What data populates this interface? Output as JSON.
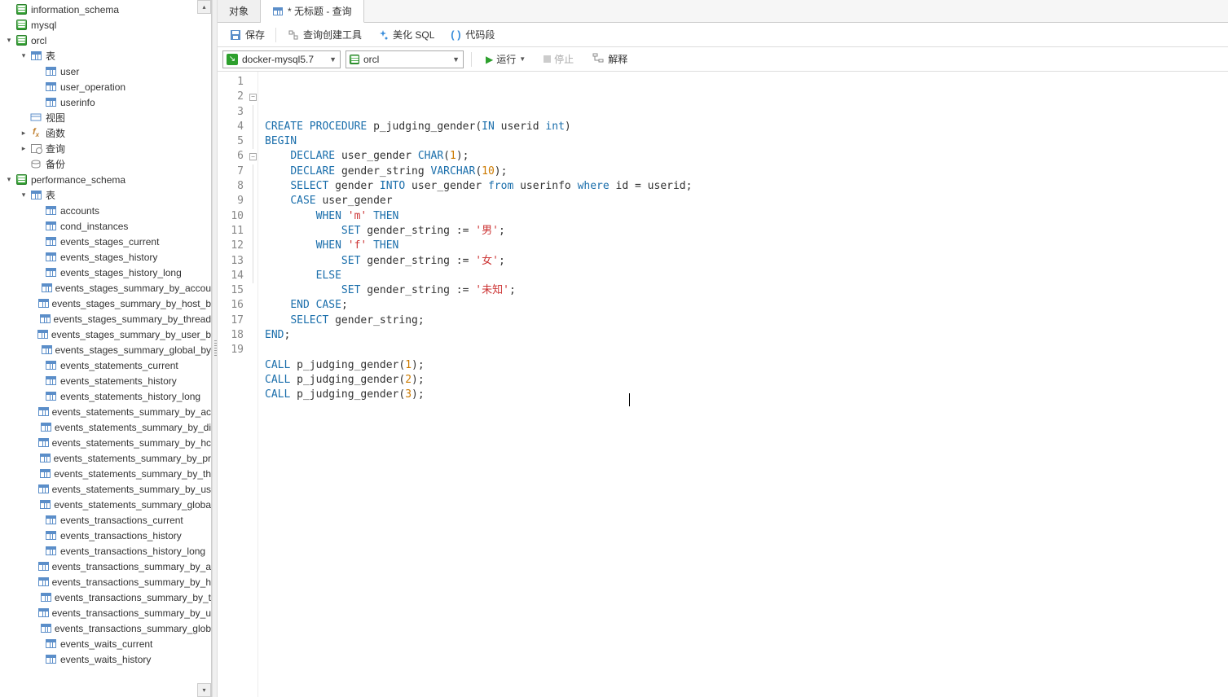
{
  "sidebar": {
    "nodes": [
      {
        "depth": 0,
        "arrow": "none",
        "icon": "db",
        "label": "information_schema"
      },
      {
        "depth": 0,
        "arrow": "none",
        "icon": "db",
        "label": "mysql"
      },
      {
        "depth": 0,
        "arrow": "open",
        "icon": "db",
        "label": "orcl"
      },
      {
        "depth": 1,
        "arrow": "open",
        "icon": "folder-table",
        "label": "表"
      },
      {
        "depth": 2,
        "arrow": "none",
        "icon": "table",
        "label": "user"
      },
      {
        "depth": 2,
        "arrow": "none",
        "icon": "table",
        "label": "user_operation"
      },
      {
        "depth": 2,
        "arrow": "none",
        "icon": "table",
        "label": "userinfo"
      },
      {
        "depth": 1,
        "arrow": "none",
        "icon": "view",
        "label": "视图"
      },
      {
        "depth": 1,
        "arrow": "closed",
        "icon": "fx",
        "label": "函数"
      },
      {
        "depth": 1,
        "arrow": "closed",
        "icon": "query",
        "label": "查询"
      },
      {
        "depth": 1,
        "arrow": "none",
        "icon": "backup",
        "label": "备份"
      },
      {
        "depth": 0,
        "arrow": "open",
        "icon": "db",
        "label": "performance_schema"
      },
      {
        "depth": 1,
        "arrow": "open",
        "icon": "folder-table",
        "label": "表"
      },
      {
        "depth": 2,
        "arrow": "none",
        "icon": "table",
        "label": "accounts"
      },
      {
        "depth": 2,
        "arrow": "none",
        "icon": "table",
        "label": "cond_instances"
      },
      {
        "depth": 2,
        "arrow": "none",
        "icon": "table",
        "label": "events_stages_current"
      },
      {
        "depth": 2,
        "arrow": "none",
        "icon": "table",
        "label": "events_stages_history"
      },
      {
        "depth": 2,
        "arrow": "none",
        "icon": "table",
        "label": "events_stages_history_long"
      },
      {
        "depth": 2,
        "arrow": "none",
        "icon": "table",
        "label": "events_stages_summary_by_accou"
      },
      {
        "depth": 2,
        "arrow": "none",
        "icon": "table",
        "label": "events_stages_summary_by_host_b"
      },
      {
        "depth": 2,
        "arrow": "none",
        "icon": "table",
        "label": "events_stages_summary_by_thread"
      },
      {
        "depth": 2,
        "arrow": "none",
        "icon": "table",
        "label": "events_stages_summary_by_user_b"
      },
      {
        "depth": 2,
        "arrow": "none",
        "icon": "table",
        "label": "events_stages_summary_global_by"
      },
      {
        "depth": 2,
        "arrow": "none",
        "icon": "table",
        "label": "events_statements_current"
      },
      {
        "depth": 2,
        "arrow": "none",
        "icon": "table",
        "label": "events_statements_history"
      },
      {
        "depth": 2,
        "arrow": "none",
        "icon": "table",
        "label": "events_statements_history_long"
      },
      {
        "depth": 2,
        "arrow": "none",
        "icon": "table",
        "label": "events_statements_summary_by_ac"
      },
      {
        "depth": 2,
        "arrow": "none",
        "icon": "table",
        "label": "events_statements_summary_by_di"
      },
      {
        "depth": 2,
        "arrow": "none",
        "icon": "table",
        "label": "events_statements_summary_by_hc"
      },
      {
        "depth": 2,
        "arrow": "none",
        "icon": "table",
        "label": "events_statements_summary_by_pr"
      },
      {
        "depth": 2,
        "arrow": "none",
        "icon": "table",
        "label": "events_statements_summary_by_th"
      },
      {
        "depth": 2,
        "arrow": "none",
        "icon": "table",
        "label": "events_statements_summary_by_us"
      },
      {
        "depth": 2,
        "arrow": "none",
        "icon": "table",
        "label": "events_statements_summary_globa"
      },
      {
        "depth": 2,
        "arrow": "none",
        "icon": "table",
        "label": "events_transactions_current"
      },
      {
        "depth": 2,
        "arrow": "none",
        "icon": "table",
        "label": "events_transactions_history"
      },
      {
        "depth": 2,
        "arrow": "none",
        "icon": "table",
        "label": "events_transactions_history_long"
      },
      {
        "depth": 2,
        "arrow": "none",
        "icon": "table",
        "label": "events_transactions_summary_by_a"
      },
      {
        "depth": 2,
        "arrow": "none",
        "icon": "table",
        "label": "events_transactions_summary_by_h"
      },
      {
        "depth": 2,
        "arrow": "none",
        "icon": "table",
        "label": "events_transactions_summary_by_t"
      },
      {
        "depth": 2,
        "arrow": "none",
        "icon": "table",
        "label": "events_transactions_summary_by_u"
      },
      {
        "depth": 2,
        "arrow": "none",
        "icon": "table",
        "label": "events_transactions_summary_glob"
      },
      {
        "depth": 2,
        "arrow": "none",
        "icon": "table",
        "label": "events_waits_current"
      },
      {
        "depth": 2,
        "arrow": "none",
        "icon": "table",
        "label": "events_waits_history"
      }
    ]
  },
  "tabs": {
    "objects_label": "对象",
    "query_label": "* 无标题 - 查询"
  },
  "toolbar": {
    "save": "保存",
    "builder": "查询创建工具",
    "beautify": "美化 SQL",
    "snippet": "代码段"
  },
  "connrow": {
    "connection": "docker-mysql5.7",
    "database": "orcl",
    "run": "运行",
    "stop": "停止",
    "explain": "解释"
  },
  "code": {
    "lines": [
      {
        "n": 1,
        "tokens": [
          [
            "kw",
            "CREATE"
          ],
          [
            " ",
            " "
          ],
          [
            "kw",
            "PROCEDURE"
          ],
          [
            " ",
            " "
          ],
          [
            "ident",
            "p_judging_gender"
          ],
          [
            "paren",
            "("
          ],
          [
            "kw",
            "IN"
          ],
          [
            " ",
            " "
          ],
          [
            "ident",
            "userid "
          ],
          [
            "type",
            "int"
          ],
          [
            "paren",
            ")"
          ]
        ]
      },
      {
        "n": 2,
        "fold": "open",
        "tokens": [
          [
            "kw",
            "BEGIN"
          ]
        ]
      },
      {
        "n": 3,
        "tokens": [
          [
            " ",
            "    "
          ],
          [
            "kw",
            "DECLARE"
          ],
          [
            " ",
            " "
          ],
          [
            "ident",
            "user_gender "
          ],
          [
            "type",
            "CHAR"
          ],
          [
            "paren",
            "("
          ],
          [
            "num",
            "1"
          ],
          [
            "paren",
            ")"
          ],
          [
            "ident",
            ";"
          ]
        ]
      },
      {
        "n": 4,
        "tokens": [
          [
            " ",
            "    "
          ],
          [
            "kw",
            "DECLARE"
          ],
          [
            " ",
            " "
          ],
          [
            "ident",
            "gender_string "
          ],
          [
            "type",
            "VARCHAR"
          ],
          [
            "paren",
            "("
          ],
          [
            "num",
            "10"
          ],
          [
            "paren",
            ")"
          ],
          [
            "ident",
            ";"
          ]
        ]
      },
      {
        "n": 5,
        "tokens": [
          [
            " ",
            "    "
          ],
          [
            "kw",
            "SELECT"
          ],
          [
            " ",
            " "
          ],
          [
            "ident",
            "gender "
          ],
          [
            "kw",
            "INTO"
          ],
          [
            " ",
            " "
          ],
          [
            "ident",
            "user_gender "
          ],
          [
            "kw",
            "from"
          ],
          [
            " ",
            " "
          ],
          [
            "ident",
            "userinfo "
          ],
          [
            "kw",
            "where"
          ],
          [
            " ",
            " "
          ],
          [
            "ident",
            "id = userid;"
          ]
        ]
      },
      {
        "n": 6,
        "fold": "open",
        "tokens": [
          [
            " ",
            "    "
          ],
          [
            "kw",
            "CASE"
          ],
          [
            " ",
            " "
          ],
          [
            "ident",
            "user_gender"
          ]
        ]
      },
      {
        "n": 7,
        "tokens": [
          [
            " ",
            "        "
          ],
          [
            "kw",
            "WHEN"
          ],
          [
            " ",
            " "
          ],
          [
            "str",
            "'m'"
          ],
          [
            " ",
            " "
          ],
          [
            "kw",
            "THEN"
          ]
        ]
      },
      {
        "n": 8,
        "tokens": [
          [
            " ",
            "            "
          ],
          [
            "kw",
            "SET"
          ],
          [
            " ",
            " "
          ],
          [
            "ident",
            "gender_string := "
          ],
          [
            "str",
            "'男'"
          ],
          [
            "ident",
            ";"
          ]
        ]
      },
      {
        "n": 9,
        "tokens": [
          [
            " ",
            "        "
          ],
          [
            "kw",
            "WHEN"
          ],
          [
            " ",
            " "
          ],
          [
            "str",
            "'f'"
          ],
          [
            " ",
            " "
          ],
          [
            "kw",
            "THEN"
          ]
        ]
      },
      {
        "n": 10,
        "tokens": [
          [
            " ",
            "            "
          ],
          [
            "kw",
            "SET"
          ],
          [
            " ",
            " "
          ],
          [
            "ident",
            "gender_string := "
          ],
          [
            "str",
            "'女'"
          ],
          [
            "ident",
            ";"
          ]
        ]
      },
      {
        "n": 11,
        "tokens": [
          [
            " ",
            "        "
          ],
          [
            "kw",
            "ELSE"
          ]
        ]
      },
      {
        "n": 12,
        "tokens": [
          [
            " ",
            "            "
          ],
          [
            "kw",
            "SET"
          ],
          [
            " ",
            " "
          ],
          [
            "ident",
            "gender_string := "
          ],
          [
            "str",
            "'未知'"
          ],
          [
            "ident",
            ";"
          ]
        ]
      },
      {
        "n": 13,
        "tokens": [
          [
            " ",
            "    "
          ],
          [
            "kw",
            "END"
          ],
          [
            " ",
            " "
          ],
          [
            "kw",
            "CASE"
          ],
          [
            "ident",
            ";"
          ]
        ]
      },
      {
        "n": 14,
        "tokens": [
          [
            " ",
            "    "
          ],
          [
            "kw",
            "SELECT"
          ],
          [
            " ",
            " "
          ],
          [
            "ident",
            "gender_string;"
          ]
        ]
      },
      {
        "n": 15,
        "tokens": [
          [
            "kw",
            "END"
          ],
          [
            "ident",
            ";"
          ]
        ]
      },
      {
        "n": 16,
        "tokens": []
      },
      {
        "n": 17,
        "tokens": [
          [
            "kw",
            "CALL"
          ],
          [
            " ",
            " "
          ],
          [
            "ident",
            "p_judging_gender"
          ],
          [
            "paren",
            "("
          ],
          [
            "num",
            "1"
          ],
          [
            "paren",
            ")"
          ],
          [
            "ident",
            ";"
          ]
        ]
      },
      {
        "n": 18,
        "tokens": [
          [
            "kw",
            "CALL"
          ],
          [
            " ",
            " "
          ],
          [
            "ident",
            "p_judging_gender"
          ],
          [
            "paren",
            "("
          ],
          [
            "num",
            "2"
          ],
          [
            "paren",
            ")"
          ],
          [
            "ident",
            ";"
          ]
        ]
      },
      {
        "n": 19,
        "tokens": [
          [
            "kw",
            "CALL"
          ],
          [
            " ",
            " "
          ],
          [
            "ident",
            "p_judging_gender"
          ],
          [
            "paren",
            "("
          ],
          [
            "num",
            "3"
          ],
          [
            "paren",
            ")"
          ],
          [
            "ident",
            ";"
          ]
        ]
      }
    ]
  }
}
